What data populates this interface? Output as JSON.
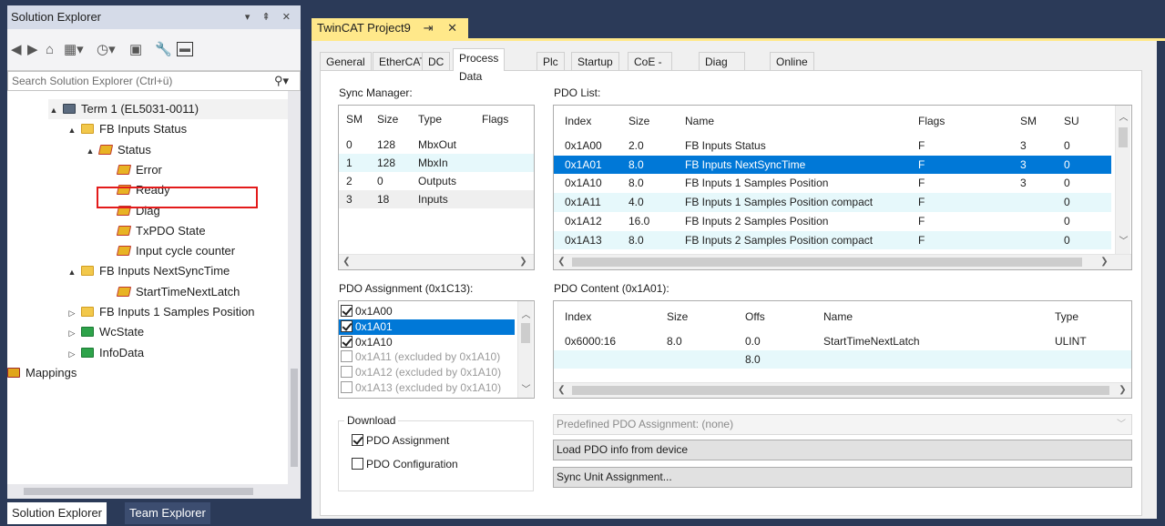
{
  "solution_explorer": {
    "title": "Solution Explorer",
    "title_buttons": "▾ ⇞ ✕",
    "search_placeholder": "Search Solution Explorer (Ctrl+ü)",
    "tree": [
      {
        "label": "Term 1 (EL5031-0011)",
        "icon": "terminal-icon",
        "arrow": "▲",
        "indent": 45
      },
      {
        "label": "FB Inputs Status",
        "icon": "folder-icon",
        "arrow": "▲",
        "indent": 65
      },
      {
        "label": "Status",
        "icon": "variable-icon",
        "arrow": "▲",
        "indent": 85
      },
      {
        "label": "Error",
        "icon": "variable-icon",
        "arrow": "",
        "indent": 105
      },
      {
        "label": "Ready",
        "icon": "variable-icon",
        "arrow": "",
        "indent": 105
      },
      {
        "label": "Diag",
        "icon": "variable-icon",
        "arrow": "",
        "indent": 105
      },
      {
        "label": "TxPDO State",
        "icon": "variable-icon",
        "arrow": "",
        "indent": 105
      },
      {
        "label": "Input cycle counter",
        "icon": "variable-icon",
        "arrow": "",
        "indent": 105
      },
      {
        "label": "FB Inputs NextSyncTime",
        "icon": "folder-icon",
        "arrow": "▲",
        "indent": 65
      },
      {
        "label": "StartTimeNextLatch",
        "icon": "variable-icon",
        "arrow": "",
        "indent": 105
      },
      {
        "label": "FB Inputs 1 Samples Position",
        "icon": "folder-icon",
        "arrow": "▷",
        "indent": 65
      },
      {
        "label": "WcState",
        "icon": "green-box-icon",
        "arrow": "▷",
        "indent": 65
      },
      {
        "label": "InfoData",
        "icon": "green-box-icon",
        "arrow": "▷",
        "indent": 65
      },
      {
        "label": "Mappings",
        "icon": "mappings-icon",
        "arrow": "",
        "indent": 0
      }
    ],
    "tabs": [
      "Solution Explorer",
      "Team Explorer"
    ]
  },
  "document_tab": {
    "title": "TwinCAT Project9",
    "buttons": "⇥ ✕"
  },
  "inner_tabs": [
    "General",
    "EtherCAT",
    "DC",
    "Process Data",
    "Plc",
    "Startup",
    "CoE - Online",
    "Diag History",
    "Online"
  ],
  "active_inner_tab": "Process Data",
  "sync_manager": {
    "label": "Sync Manager:",
    "columns": [
      "SM",
      "Size",
      "Type",
      "Flags"
    ],
    "rows": [
      [
        "0",
        "128",
        "MbxOut",
        ""
      ],
      [
        "1",
        "128",
        "MbxIn",
        ""
      ],
      [
        "2",
        "0",
        "Outputs",
        ""
      ],
      [
        "3",
        "18",
        "Inputs",
        ""
      ]
    ]
  },
  "pdo_list": {
    "label": "PDO List:",
    "columns": [
      "Index",
      "Size",
      "Name",
      "Flags",
      "SM",
      "SU"
    ],
    "rows": [
      [
        "0x1A00",
        "2.0",
        "FB Inputs Status",
        "F",
        "3",
        "0"
      ],
      [
        "0x1A01",
        "8.0",
        "FB Inputs NextSyncTime",
        "F",
        "3",
        "0"
      ],
      [
        "0x1A10",
        "8.0",
        "FB Inputs 1 Samples Position",
        "F",
        "3",
        "0"
      ],
      [
        "0x1A11",
        "4.0",
        "FB Inputs 1 Samples Position compact",
        "F",
        "",
        "0"
      ],
      [
        "0x1A12",
        "16.0",
        "FB Inputs 2 Samples Position",
        "F",
        "",
        "0"
      ],
      [
        "0x1A13",
        "8.0",
        "FB Inputs 2 Samples Position compact",
        "F",
        "",
        "0"
      ]
    ]
  },
  "pdo_assignment": {
    "label": "PDO Assignment (0x1C13):",
    "items": [
      {
        "label": "0x1A00",
        "checked": true
      },
      {
        "label": "0x1A01",
        "checked": true
      },
      {
        "label": "0x1A10",
        "checked": true
      },
      {
        "label": "0x1A11 (excluded by 0x1A10)",
        "checked": false
      },
      {
        "label": "0x1A12 (excluded by 0x1A10)",
        "checked": false
      },
      {
        "label": "0x1A13 (excluded by 0x1A10)",
        "checked": false
      }
    ]
  },
  "pdo_content": {
    "label": "PDO Content (0x1A01):",
    "columns": [
      "Index",
      "Size",
      "Offs",
      "Name",
      "Type"
    ],
    "rows": [
      [
        "0x6000:16",
        "8.0",
        "0.0",
        "StartTimeNextLatch",
        "ULINT"
      ],
      [
        "",
        "",
        "8.0",
        "",
        ""
      ]
    ]
  },
  "download": {
    "label": "Download",
    "pdo_assignment": "PDO Assignment",
    "pdo_configuration": "PDO Configuration"
  },
  "predefined": "Predefined PDO Assignment: (none)",
  "load_button": "Load PDO info from device",
  "sync_unit_button": "Sync Unit Assignment..."
}
